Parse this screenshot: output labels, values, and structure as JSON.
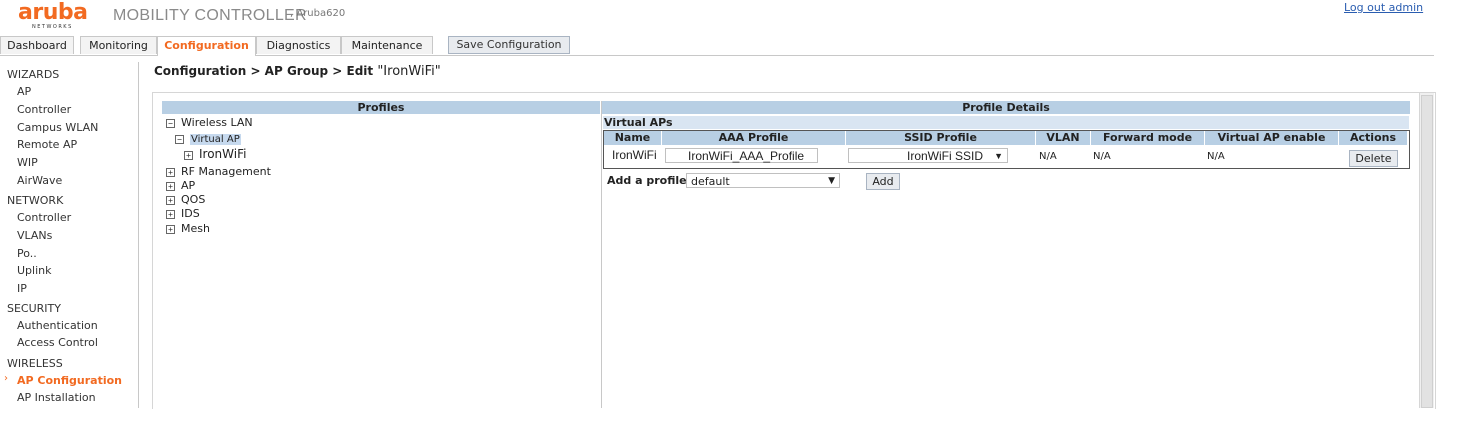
{
  "header": {
    "brand": "aruba",
    "brand_sub": "NETWORKS",
    "title": "MOBILITY CONTROLLER",
    "device": ", Aruba620",
    "logout": "Log out admin"
  },
  "tabs": [
    {
      "label": "Dashboard"
    },
    {
      "label": "Monitoring"
    },
    {
      "label": "Configuration",
      "active": true
    },
    {
      "label": "Diagnostics"
    },
    {
      "label": "Maintenance"
    }
  ],
  "save_button": "Save Configuration",
  "sidebar": {
    "wizards": {
      "heading": "WIZARDS",
      "items": [
        "AP",
        "Controller",
        "Campus WLAN",
        "Remote AP",
        "WIP",
        "AirWave"
      ]
    },
    "network": {
      "heading": "NETWORK",
      "items": [
        "Controller",
        "VLANs",
        "Po..",
        "Uplink",
        "IP"
      ]
    },
    "security": {
      "heading": "SECURITY",
      "items": [
        "Authentication",
        "Access Control"
      ]
    },
    "wireless": {
      "heading": "WIRELESS",
      "items": [
        "AP Configuration",
        "AP Installation"
      ],
      "active": "AP Configuration",
      "active_marker": "›"
    }
  },
  "breadcrumb": {
    "path": "Configuration > AP Group > Edit",
    "name": "\"IronWiFi\""
  },
  "profiles": {
    "heading": "Profiles",
    "tree": {
      "wireless_lan": "Wireless LAN",
      "virtual_ap": "Virtual AP",
      "ironwifi": "IronWiFi",
      "rf_management": "RF Management",
      "ap": "AP",
      "qos": "QOS",
      "ids": "IDS",
      "mesh": "Mesh"
    },
    "expand_glyph": "+",
    "collapse_glyph": "−"
  },
  "details": {
    "heading": "Profile Details",
    "section_title": "Virtual APs",
    "columns": [
      "Name",
      "AAA Profile",
      "SSID Profile",
      "VLAN",
      "Forward mode",
      "Virtual AP enable",
      "Actions"
    ],
    "row": {
      "name": "IronWiFi",
      "aaa_profile": "IronWiFi_AAA_Profile",
      "ssid_profile": "IronWiFi SSID",
      "vlan": "N/A",
      "forward_mode": "N/A",
      "vap_enable": "N/A",
      "action": "Delete"
    },
    "dropdown_glyph": "▼",
    "add_profile_label": "Add a profile",
    "add_profile_value": "default",
    "add_button": "Add"
  },
  "colors": {
    "accent": "#f26a21",
    "header_blue": "#b8cfe4",
    "link": "#2a5db0"
  }
}
